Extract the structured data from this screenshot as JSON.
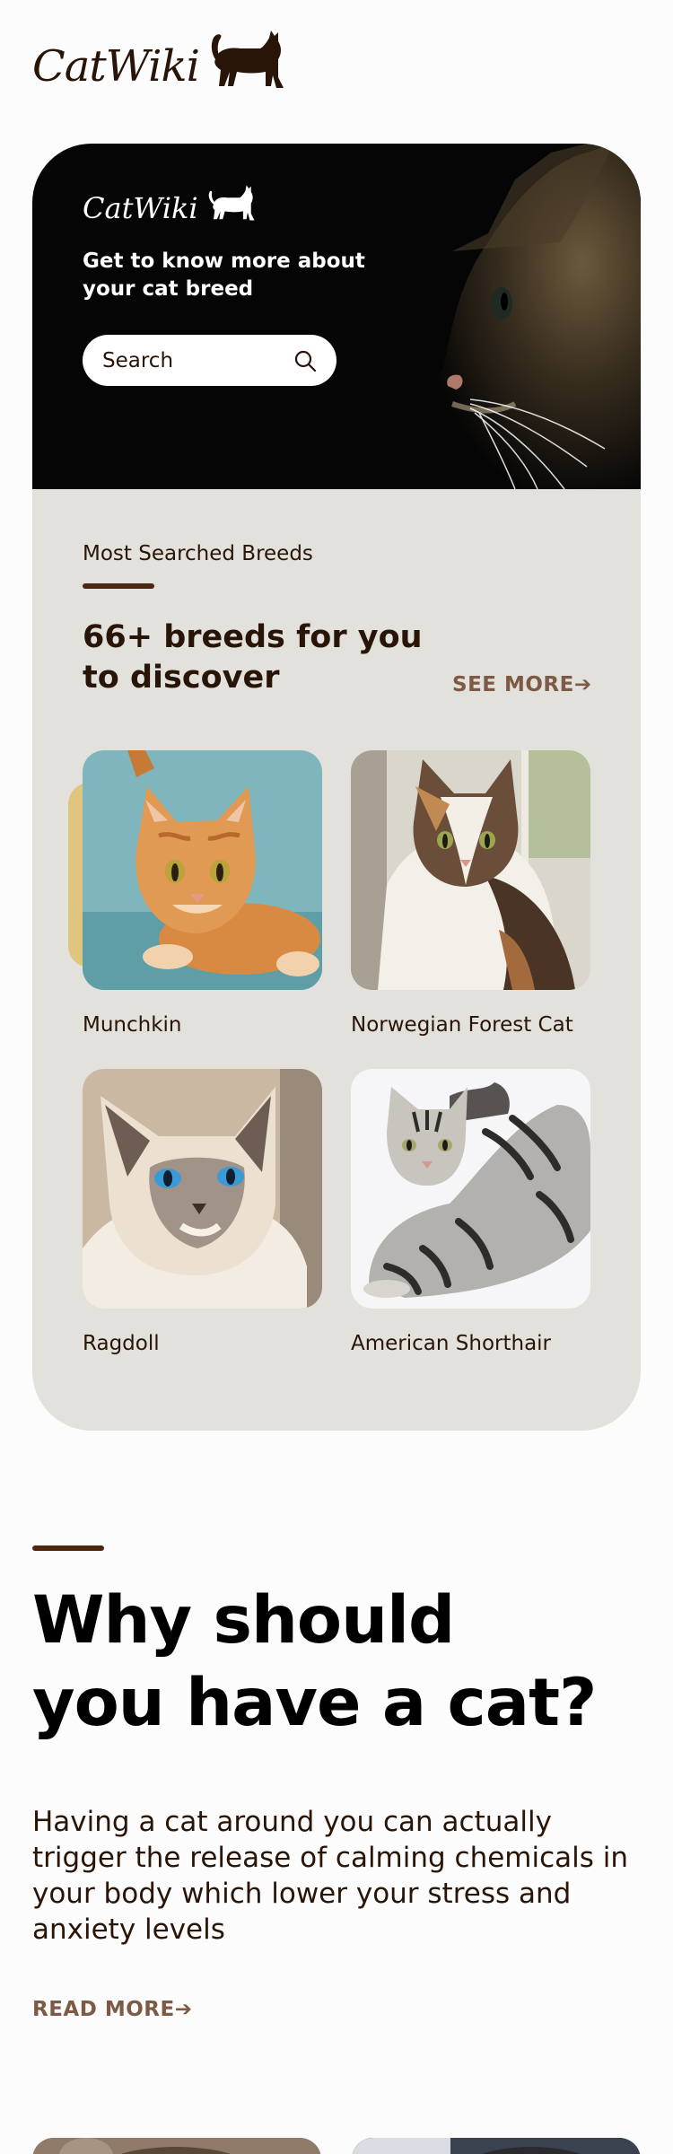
{
  "header": {
    "brand": "CatWiki"
  },
  "hero": {
    "brand": "CatWiki",
    "tagline": "Get to know more about your cat breed",
    "search": {
      "placeholder": "Search"
    }
  },
  "breeds_section": {
    "label": "Most Searched Breeds",
    "title": "66+ breeds for you to discover",
    "see_more": "SEE MORE",
    "arrow": "➔",
    "breeds": [
      {
        "name": "Munchkin"
      },
      {
        "name": "Norwegian Forest Cat"
      },
      {
        "name": "Ragdoll"
      },
      {
        "name": "American Shorthair"
      }
    ]
  },
  "why_section": {
    "title": "Why should you have a cat?",
    "text": "Having a cat around you can actually trigger the release of calming chemicals in your body which lower your stress and anxiety levels",
    "read_more": "READ MORE",
    "arrow": "➔"
  },
  "colors": {
    "brand_brown": "#291507",
    "accent_brown": "#4d270f",
    "link_brown": "#7c5a45",
    "card_bg": "#e3e1dc",
    "hero_bg": "#050505"
  }
}
